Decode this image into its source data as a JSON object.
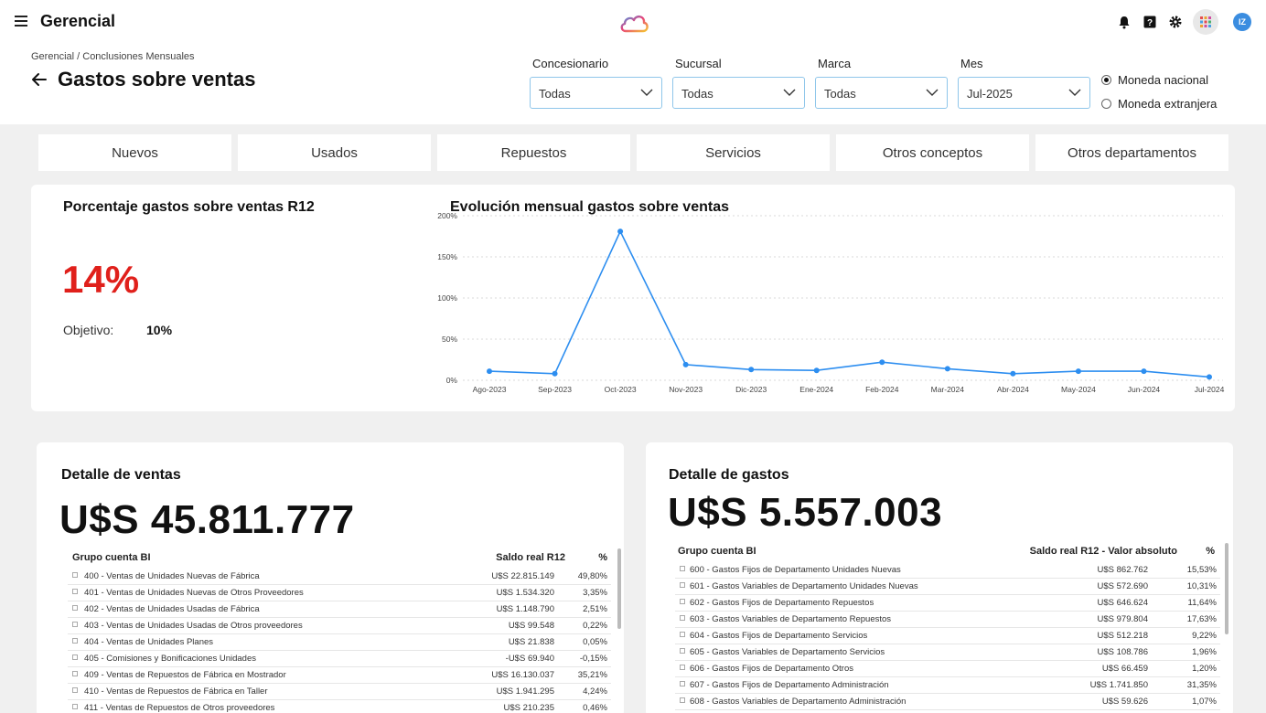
{
  "app": {
    "title": "Gerencial",
    "avatar_initials": "IZ"
  },
  "breadcrumb": "Gerencial / Conclusiones Mensuales",
  "page_title": "Gastos sobre ventas",
  "filters": [
    {
      "label": "Concesionario",
      "value": "Todas"
    },
    {
      "label": "Sucursal",
      "value": "Todas"
    },
    {
      "label": "Marca",
      "value": "Todas"
    },
    {
      "label": "Mes",
      "value": "Jul-2025"
    }
  ],
  "currency": {
    "options": [
      "Moneda nacional",
      "Moneda extranjera"
    ],
    "selected": "Moneda nacional"
  },
  "tabs": [
    "Nuevos",
    "Usados",
    "Repuestos",
    "Servicios",
    "Otros conceptos",
    "Otros departamentos"
  ],
  "kpi": {
    "title": "Porcentaje gastos sobre ventas R12",
    "value": "14%",
    "objective_label": "Objetivo:",
    "objective_value": "10%"
  },
  "chart_title": "Evolución mensual gastos sobre ventas",
  "chart_data": {
    "type": "line",
    "title": "Evolución mensual gastos sobre ventas",
    "categories": [
      "Ago-2023",
      "Sep-2023",
      "Oct-2023",
      "Nov-2023",
      "Dic-2023",
      "Ene-2024",
      "Feb-2024",
      "Mar-2024",
      "Abr-2024",
      "May-2024",
      "Jun-2024",
      "Jul-2024"
    ],
    "series": [
      {
        "values": [
          11,
          8,
          181,
          19,
          13,
          12,
          22,
          14,
          8,
          11,
          11,
          4
        ]
      }
    ],
    "ylim": [
      0,
      200
    ],
    "yticks": [
      "0%",
      "50%",
      "100%",
      "150%",
      "200%"
    ],
    "grid": true,
    "color": "#2d8ef0"
  },
  "ventas": {
    "title": "Detalle de ventas",
    "total": "U$S 45.811.777",
    "headers": {
      "group": "Grupo cuenta BI",
      "amount": "Saldo real R12",
      "pct": "%"
    },
    "rows": [
      {
        "name": "400 - Ventas de Unidades Nuevas de Fábrica",
        "amount": "U$S 22.815.149",
        "pct": "49,80%"
      },
      {
        "name": "401 - Ventas de Unidades Nuevas de Otros Proveedores",
        "amount": "U$S 1.534.320",
        "pct": "3,35%"
      },
      {
        "name": "402 - Ventas de Unidades Usadas de Fábrica",
        "amount": "U$S 1.148.790",
        "pct": "2,51%"
      },
      {
        "name": "403 - Ventas de Unidades Usadas de Otros proveedores",
        "amount": "U$S 99.548",
        "pct": "0,22%"
      },
      {
        "name": "404 - Ventas de Unidades Planes",
        "amount": "U$S 21.838",
        "pct": "0,05%"
      },
      {
        "name": "405 - Comisiones y Bonificaciones Unidades",
        "amount": "-U$S 69.940",
        "pct": "-0,15%"
      },
      {
        "name": "409 - Ventas de Repuestos de Fábrica en Mostrador",
        "amount": "U$S 16.130.037",
        "pct": "35,21%"
      },
      {
        "name": "410 - Ventas de Repuestos de Fábrica en Taller",
        "amount": "U$S 1.941.295",
        "pct": "4,24%"
      },
      {
        "name": "411 - Ventas de Repuestos de Otros proveedores",
        "amount": "U$S 210.235",
        "pct": "0,46%"
      }
    ]
  },
  "gastos": {
    "title": "Detalle de gastos",
    "total": "U$S 5.557.003",
    "headers": {
      "group": "Grupo cuenta BI",
      "amount": "Saldo real R12 - Valor absoluto",
      "pct": "%"
    },
    "rows": [
      {
        "name": "600 - Gastos Fijos de Departamento Unidades Nuevas",
        "amount": "U$S 862.762",
        "pct": "15,53%"
      },
      {
        "name": "601 - Gastos Variables de Departamento Unidades Nuevas",
        "amount": "U$S 572.690",
        "pct": "10,31%"
      },
      {
        "name": "602 - Gastos Fijos de Departamento Repuestos",
        "amount": "U$S 646.624",
        "pct": "11,64%"
      },
      {
        "name": "603 - Gastos Variables de Departamento Repuestos",
        "amount": "U$S 979.804",
        "pct": "17,63%"
      },
      {
        "name": "604 - Gastos Fijos de Departamento Servicios",
        "amount": "U$S 512.218",
        "pct": "9,22%"
      },
      {
        "name": "605 - Gastos Variables de Departamento Servicios",
        "amount": "U$S 108.786",
        "pct": "1,96%"
      },
      {
        "name": "606 - Gastos Fijos de Departamento Otros",
        "amount": "U$S 66.459",
        "pct": "1,20%"
      },
      {
        "name": "607 - Gastos Fijos de Departamento Administración",
        "amount": "U$S 1.741.850",
        "pct": "31,35%"
      },
      {
        "name": "608 - Gastos Variables de Departamento Administración",
        "amount": "U$S 59.626",
        "pct": "1,07%"
      }
    ]
  },
  "colors": {
    "accent": "#2d8ef0",
    "kpi": "#e0201b",
    "filter_border": "#8fc6ea"
  },
  "icons": [
    "menu-icon",
    "cloud-logo-icon",
    "bell-icon",
    "help-icon",
    "gear-icon",
    "apps-icon",
    "back-arrow-icon",
    "chevron-down-icon",
    "expand-icon"
  ]
}
